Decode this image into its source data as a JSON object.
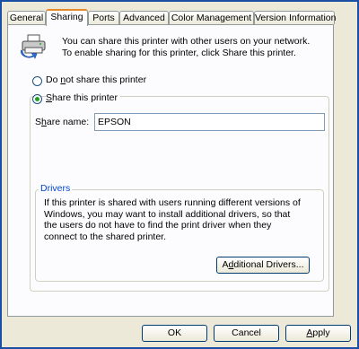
{
  "tabs": [
    {
      "label": "General"
    },
    {
      "label": "Sharing"
    },
    {
      "label": "Ports"
    },
    {
      "label": "Advanced"
    },
    {
      "label": "Color Management"
    },
    {
      "label": "Version Information"
    }
  ],
  "active_tab": "Sharing",
  "info": {
    "text": "You can share this printer with other users on your network. To enable sharing for this printer, click Share this printer.",
    "icon": "shared-printer-icon"
  },
  "options": {
    "do_not_share": {
      "pre": "Do ",
      "accel": "n",
      "post": "ot share this printer",
      "selected": false
    },
    "share": {
      "pre": "",
      "accel": "S",
      "post": "hare this printer",
      "selected": true
    }
  },
  "share_name": {
    "label_accel": "h",
    "label_pre": "S",
    "label_post": "are name:",
    "value": "EPSON"
  },
  "drivers": {
    "title": "Drivers",
    "text": "If this printer is shared with users running different versions of Windows, you may want to install additional drivers, so that the users do not have to find the print driver when they connect to the shared printer.",
    "button_pre": "A",
    "button_accel": "d",
    "button_post": "ditional Drivers..."
  },
  "buttons": {
    "ok": "OK",
    "cancel": "Cancel",
    "apply_accel": "A",
    "apply_post": "pply"
  },
  "colors": {
    "window_border": "#1a4fa3",
    "dialog_bg": "#ece9d8",
    "active_tab_accent": "#e68b2c",
    "group_title": "#0046d5"
  }
}
